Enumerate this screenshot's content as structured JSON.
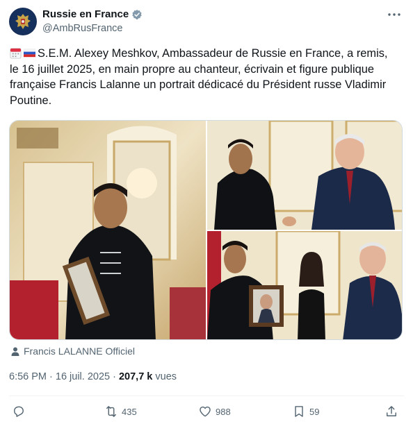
{
  "account": {
    "display_name": "Russie en France",
    "handle": "@AmbRusFrance",
    "avatar_icon": "coat-of-arms-icon",
    "verified_icon": "verified-badge-icon",
    "verified_color": "#829aab"
  },
  "tweet": {
    "emojis": [
      "calendar-icon",
      "russian-flag-icon"
    ],
    "text": "S.E.M. Alexey Meshkov, Ambassadeur de Russie en France, a remis, le 16 juillet 2025, en main propre au chanteur, écrivain et figure publique française Francis Lalanne un portrait dédicacé du Président russe Vladimir Poutine."
  },
  "media": {
    "photo_count": 3
  },
  "attribution": {
    "icon": "person-icon",
    "text": "Francis LALANNE Officiel"
  },
  "meta": {
    "timestamp": "6:56 PM · 16 juil. 2025",
    "separator": " · ",
    "views_count": "207,7 k",
    "views_label": "vues"
  },
  "actions": {
    "reply": {
      "icon": "reply-icon",
      "count": ""
    },
    "retweet": {
      "icon": "retweet-icon",
      "count": "435"
    },
    "like": {
      "icon": "heart-icon",
      "count": "988"
    },
    "bookmark": {
      "icon": "bookmark-icon",
      "count": "59"
    },
    "share": {
      "icon": "share-icon"
    }
  },
  "colors": {
    "text_primary": "#0f1419",
    "text_secondary": "#536471",
    "border": "#cfd9de"
  }
}
